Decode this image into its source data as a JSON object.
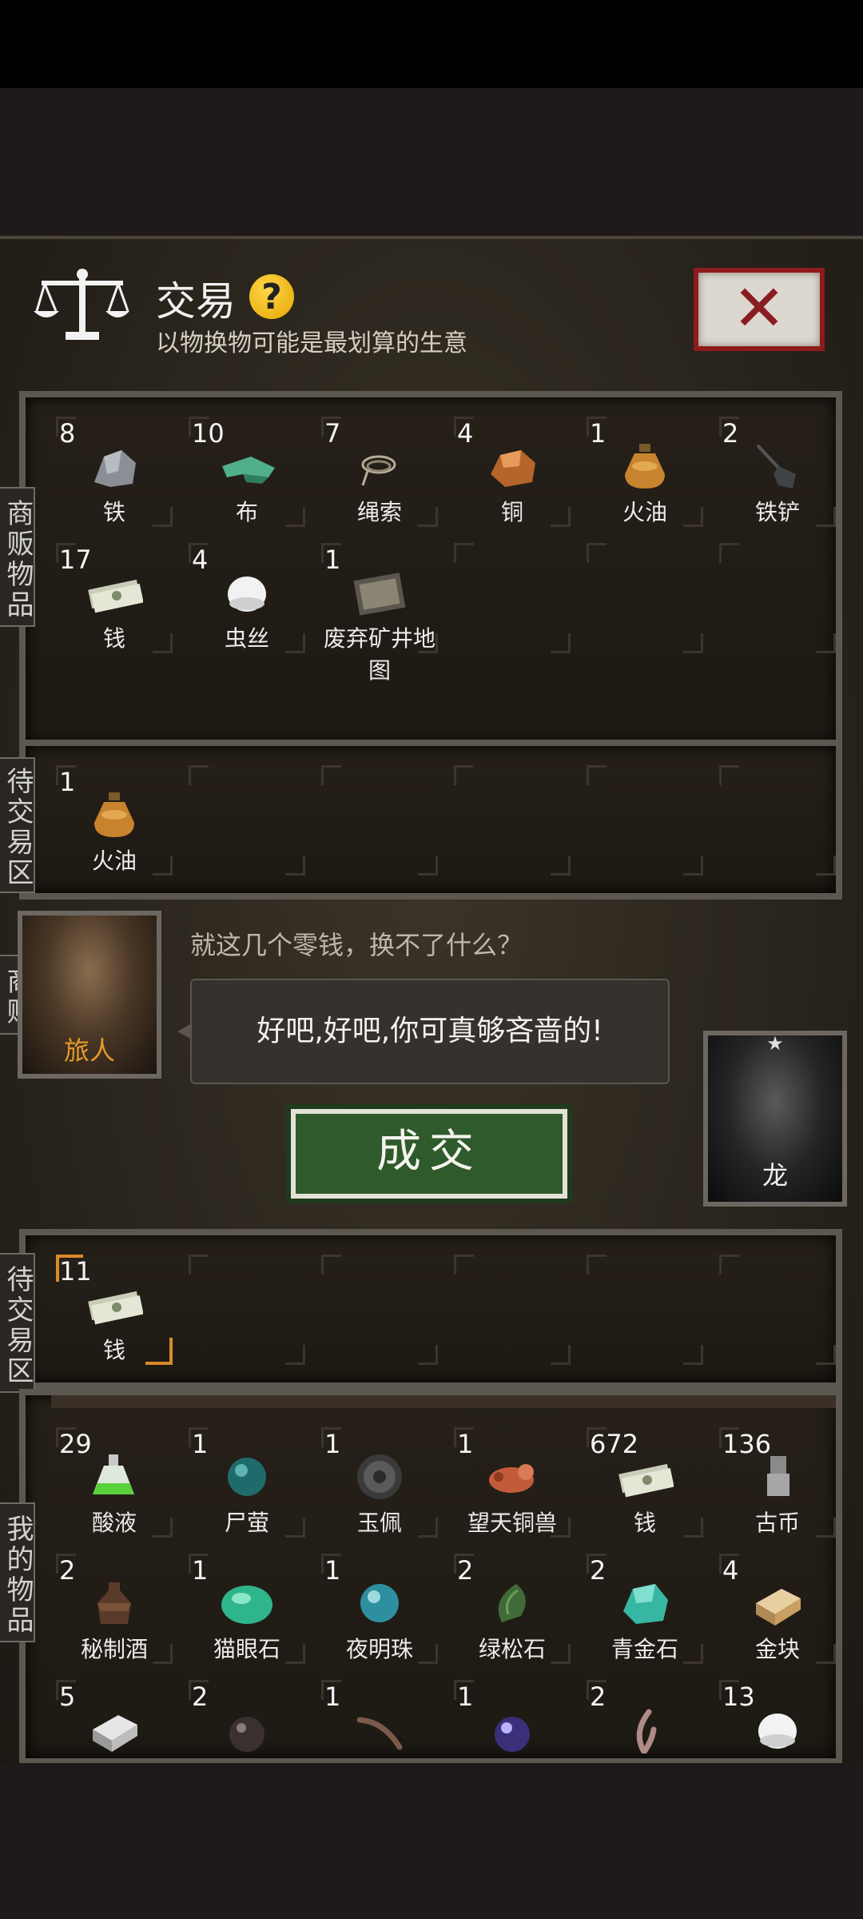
{
  "header": {
    "title": "交易",
    "help_glyph": "?",
    "subtitle": "以物换物可能是最划算的生意",
    "close_glyph": "✕"
  },
  "merchant_goods": {
    "label": "商贩物品",
    "items": [
      {
        "qty": "8",
        "name": "铁",
        "icon": "iron-ore-icon"
      },
      {
        "qty": "10",
        "name": "布",
        "icon": "cloth-icon"
      },
      {
        "qty": "7",
        "name": "绳索",
        "icon": "rope-icon"
      },
      {
        "qty": "4",
        "name": "铜",
        "icon": "copper-ore-icon"
      },
      {
        "qty": "1",
        "name": "火油",
        "icon": "kerosene-icon"
      },
      {
        "qty": "2",
        "name": "铁铲",
        "icon": "shovel-icon"
      },
      {
        "qty": "17",
        "name": "钱",
        "icon": "money-icon"
      },
      {
        "qty": "4",
        "name": "虫丝",
        "icon": "silk-icon"
      },
      {
        "qty": "1",
        "name": "废弃矿井地图",
        "icon": "map-icon"
      }
    ]
  },
  "merchant_trade": {
    "label": "待交易区",
    "items": [
      {
        "qty": "1",
        "name": "火油",
        "icon": "kerosene-icon"
      }
    ]
  },
  "dialog": {
    "merchant_tag": "商贩",
    "merchant_name": "旅人",
    "merchant_line": "就这几个零钱，换不了什么？",
    "player_reply": "好吧,好吧,你可真够吝啬的!",
    "player_name": "龙",
    "deal_button": "成交"
  },
  "player_trade": {
    "label": "待交易区",
    "items": [
      {
        "qty": "11",
        "name": "钱",
        "icon": "money-icon"
      }
    ]
  },
  "my_goods": {
    "label": "我的物品",
    "items": [
      {
        "qty": "29",
        "name": "酸液",
        "icon": "acid-flask-icon"
      },
      {
        "qty": "1",
        "name": "尸萤",
        "icon": "teal-orb-icon"
      },
      {
        "qty": "1",
        "name": "玉佩",
        "icon": "jade-pendant-icon"
      },
      {
        "qty": "1",
        "name": "望天铜兽",
        "icon": "bronze-beast-icon"
      },
      {
        "qty": "672",
        "name": "钱",
        "icon": "money-icon"
      },
      {
        "qty": "136",
        "name": "古币",
        "icon": "ancient-coin-icon"
      },
      {
        "qty": "2",
        "name": "秘制酒",
        "icon": "wine-jar-icon"
      },
      {
        "qty": "1",
        "name": "猫眼石",
        "icon": "cat-eye-stone-icon"
      },
      {
        "qty": "1",
        "name": "夜明珠",
        "icon": "night-pearl-icon"
      },
      {
        "qty": "2",
        "name": "绿松石",
        "icon": "turquoise-icon"
      },
      {
        "qty": "2",
        "name": "青金石",
        "icon": "lapis-icon"
      },
      {
        "qty": "4",
        "name": "金块",
        "icon": "gold-bar-icon"
      },
      {
        "qty": "5",
        "name": "",
        "icon": "silver-bar-icon"
      },
      {
        "qty": "2",
        "name": "",
        "icon": "dark-orb-icon"
      },
      {
        "qty": "1",
        "name": "",
        "icon": "claw-icon"
      },
      {
        "qty": "1",
        "name": "",
        "icon": "crystal-ball-icon"
      },
      {
        "qty": "2",
        "name": "",
        "icon": "horn-icon"
      },
      {
        "qty": "13",
        "name": "",
        "icon": "silk-icon"
      }
    ]
  }
}
